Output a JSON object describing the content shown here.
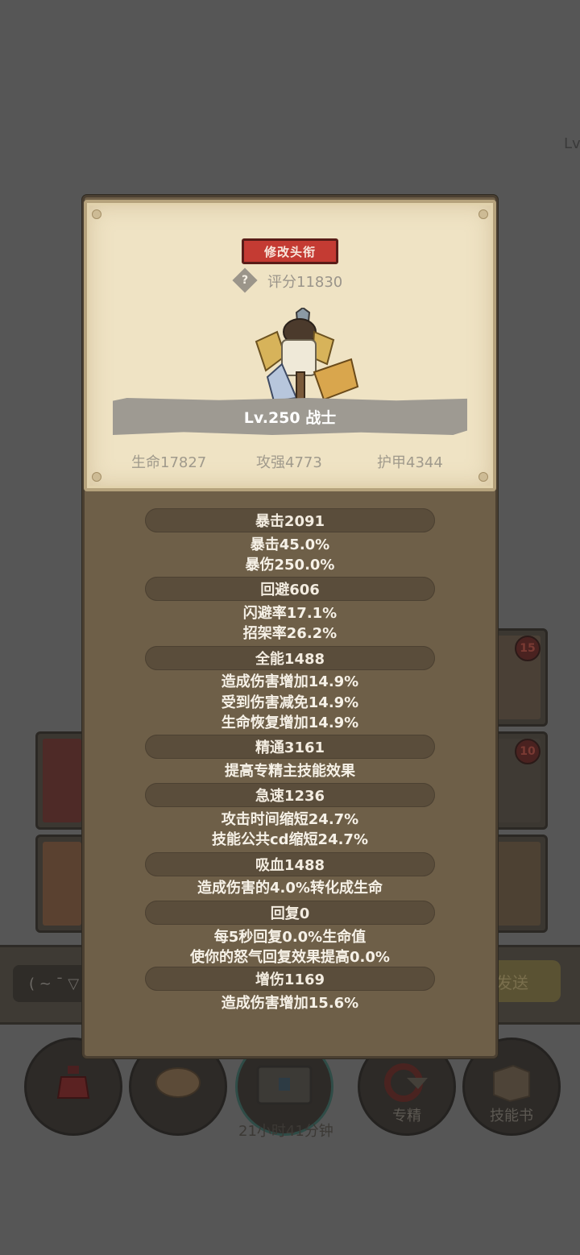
{
  "background": {
    "level_fragment": "Lv.",
    "chat_input_text": "( ~ ¯ ▽",
    "send_button": "发送",
    "timer": "21小时41分钟",
    "badges": [
      "15",
      "10"
    ],
    "bottom_buttons": [
      {
        "label": "",
        "icon": "potion-icon"
      },
      {
        "label": "",
        "icon": "bread-icon"
      },
      {
        "label": "",
        "icon": "chest-icon"
      },
      {
        "label": "专精",
        "icon": "specialization-icon"
      },
      {
        "label": "技能书",
        "icon": "skill-book-icon"
      }
    ]
  },
  "profile": {
    "edit_title_button": "修改头衔",
    "score": "评分11830",
    "level_class": "Lv.250 战士",
    "base_stats": [
      "生命17827",
      "攻强4773",
      "护甲4344"
    ]
  },
  "stats": [
    {
      "header": "暴击2091",
      "lines": [
        "暴击45.0%",
        "暴伤250.0%"
      ]
    },
    {
      "header": "回避606",
      "lines": [
        "闪避率17.1%",
        "招架率26.2%"
      ]
    },
    {
      "header": "全能1488",
      "lines": [
        "造成伤害增加14.9%",
        "受到伤害减免14.9%",
        "生命恢复增加14.9%"
      ]
    },
    {
      "header": "精通3161",
      "lines": [
        "提高专精主技能效果"
      ]
    },
    {
      "header": "急速1236",
      "lines": [
        "攻击时间缩短24.7%",
        "技能公共cd缩短24.7%"
      ]
    },
    {
      "header": "吸血1488",
      "lines": [
        "造成伤害的4.0%转化成生命"
      ]
    },
    {
      "header": "回复0",
      "lines": [
        "每5秒回复0.0%生命值",
        "使你的怒气回复效果提高0.0%"
      ]
    },
    {
      "header": "增伤1169",
      "lines": [
        "造成伤害增加15.6%"
      ]
    }
  ],
  "colors": {
    "overlay_bg": "#565656",
    "panel_brown": "#6e5f48",
    "parchment": "#efe3c4",
    "title_red": "#c43b33",
    "stat_header": "#5a4d3b"
  }
}
